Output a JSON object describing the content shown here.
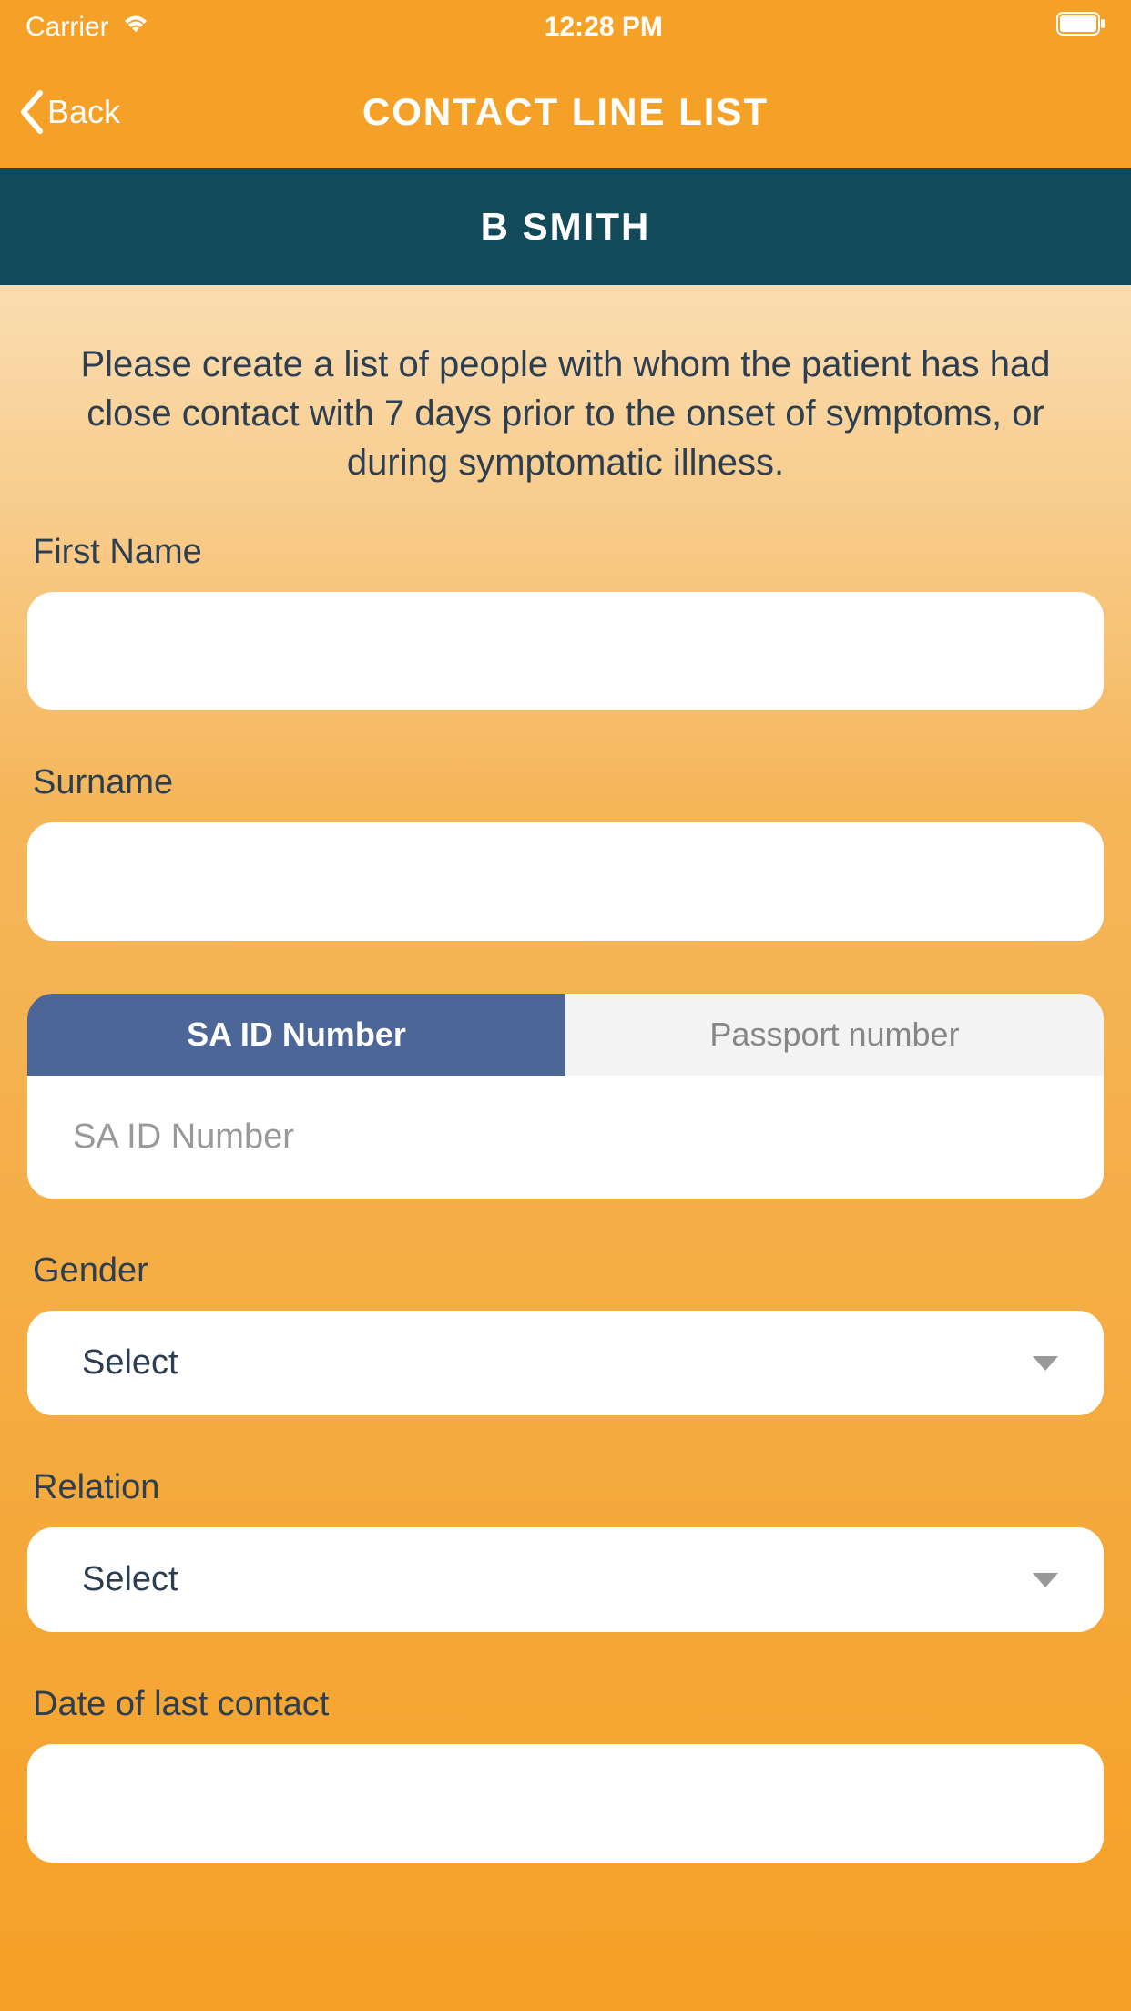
{
  "status_bar": {
    "carrier": "Carrier",
    "time": "12:28 PM"
  },
  "nav": {
    "back_label": "Back",
    "title": "CONTACT LINE LIST"
  },
  "patient_name": "B SMITH",
  "instructions": "Please create a list of people with whom the patient has had close contact with 7 days prior to the onset of symptoms, or during symptomatic illness.",
  "form": {
    "first_name": {
      "label": "First Name",
      "value": ""
    },
    "surname": {
      "label": "Surname",
      "value": ""
    },
    "id_tabs": {
      "sa_id": "SA ID Number",
      "passport": "Passport number"
    },
    "id_input": {
      "placeholder": "SA ID Number",
      "value": ""
    },
    "gender": {
      "label": "Gender",
      "selected": "Select"
    },
    "relation": {
      "label": "Relation",
      "selected": "Select"
    },
    "date_last_contact": {
      "label": "Date of last contact",
      "value": ""
    }
  }
}
